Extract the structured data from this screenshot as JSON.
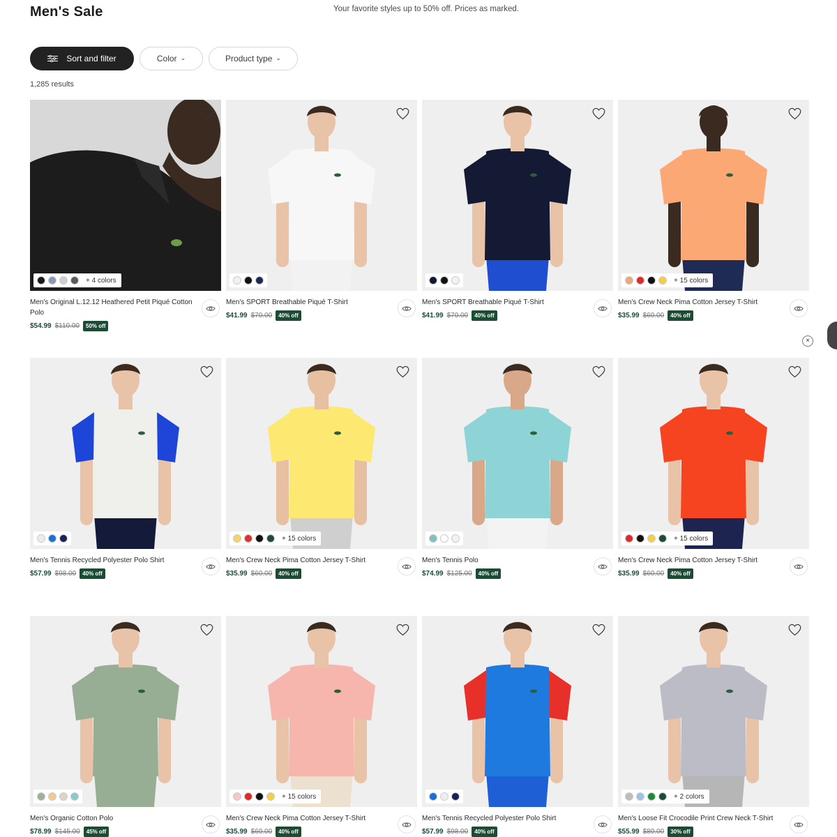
{
  "header": {
    "title": "Men's Sale",
    "promo": "Your favorite styles up to 50% off. Prices as marked."
  },
  "filters": {
    "sort_label": "Sort and filter",
    "color_label": "Color",
    "product_type_label": "Product type"
  },
  "results_count": "1,285 results",
  "products": [
    {
      "name": "Men's Original L.12.12 Heathered Petit Piqué Cotton Polo",
      "price": "$54.99",
      "was": "$110.00",
      "badge": "50% off",
      "swatches": [
        "#1a1a1a",
        "#8b97b4",
        "#cfcfcf",
        "#5a5a5a"
      ],
      "more": "+ 4 colors",
      "shirt": "#1c1c1c",
      "pants": "#1c1c1c",
      "sleeve": "#1c1c1c",
      "skin": "#3b2a20",
      "bg": "#d8d8d8"
    },
    {
      "name": "Men's SPORT Breathable Piqué T-Shirt",
      "price": "$41.99",
      "was": "$70.00",
      "badge": "40% off",
      "swatches": [
        "#f2f2f6",
        "#111111",
        "#1a2a55"
      ],
      "more": "",
      "shirt": "#f7f7f7",
      "pants": "#f2f2f2",
      "sleeve": "#f7f7f7",
      "skin": "#e8c3a8",
      "bg": "#efefef"
    },
    {
      "name": "Men's SPORT Breathable Piqué T-Shirt",
      "price": "$41.99",
      "was": "$70.00",
      "badge": "40% off",
      "swatches": [
        "#111833",
        "#111111",
        "#f2f2f6"
      ],
      "more": "",
      "shirt": "#141a33",
      "pants": "#1f4fd0",
      "sleeve": "#141a33",
      "skin": "#e8c3a8",
      "bg": "#efefef"
    },
    {
      "name": "Men's Crew Neck Pima Cotton Jersey T-Shirt",
      "price": "$35.99",
      "was": "$60.00",
      "badge": "40% off",
      "swatches": [
        "#f0a67a",
        "#e02a2a",
        "#111111",
        "#f2cf49"
      ],
      "more": "+ 15 colors",
      "shirt": "#fca874",
      "pants": "#1d2b55",
      "sleeve": "#fca874",
      "skin": "#3a2a20",
      "bg": "#efefef"
    },
    {
      "name": "Men's Tennis Recycled Polyester Polo Shirt",
      "price": "$57.99",
      "was": "$98.00",
      "badge": "40% off",
      "swatches": [
        "#ececea",
        "#1a6fd6",
        "#1a2355"
      ],
      "more": "",
      "shirt": "#efefec",
      "pants": "#141a3a",
      "sleeve": "#1d45d8",
      "skin": "#e8c3a8",
      "bg": "#efefef"
    },
    {
      "name": "Men's Crew Neck Pima Cotton Jersey T-Shirt",
      "price": "$35.99",
      "was": "$60.00",
      "badge": "40% off",
      "swatches": [
        "#f5d26a",
        "#e03030",
        "#111111",
        "#1b4d35"
      ],
      "more": "+ 15 colors",
      "shirt": "#fde972",
      "pants": "#cfcfcf",
      "sleeve": "#fde972",
      "skin": "#e6c0a0",
      "bg": "#efefef"
    },
    {
      "name": "Men's Tennis Polo",
      "price": "$74.99",
      "was": "$125.00",
      "badge": "40% off",
      "swatches": [
        "#7fc0c0",
        "#ffffff",
        "#f2f2f6"
      ],
      "more": "",
      "shirt": "#8ed3d6",
      "pants": "#f3f3f3",
      "sleeve": "#8ed3d6",
      "skin": "#d9a888",
      "bg": "#efefef"
    },
    {
      "name": "Men's Crew Neck Pima Cotton Jersey T-Shirt",
      "price": "$35.99",
      "was": "$60.00",
      "badge": "40% off",
      "swatches": [
        "#e02a2a",
        "#111111",
        "#f2cf49",
        "#1b4d35"
      ],
      "more": "+ 15 colors",
      "shirt": "#f5441f",
      "pants": "#1d2450",
      "sleeve": "#f5441f",
      "skin": "#e8c3a8",
      "bg": "#efefef"
    },
    {
      "name": "Men's Organic Cotton Polo",
      "price": "$78.99",
      "was": "$145.00",
      "badge": "45% off",
      "swatches": [
        "#9fb19a",
        "#f2c993",
        "#dcd4c6",
        "#8cc9c9"
      ],
      "more": "",
      "shirt": "#98ae94",
      "pants": "#98ae94",
      "sleeve": "#98ae94",
      "skin": "#e8c3a8",
      "bg": "#efefef"
    },
    {
      "name": "Men's Crew Neck Pima Cotton Jersey T-Shirt",
      "price": "$35.99",
      "was": "$60.00",
      "badge": "40% off",
      "swatches": [
        "#f5c8c8",
        "#e02a2a",
        "#111111",
        "#f2cf49"
      ],
      "more": "+ 15 colors",
      "shirt": "#f6b5ad",
      "pants": "#ece1cf",
      "sleeve": "#f6b5ad",
      "skin": "#e8c3a8",
      "bg": "#efefef"
    },
    {
      "name": "Men's Tennis Recycled Polyester Polo Shirt",
      "price": "$57.99",
      "was": "$98.00",
      "badge": "40% off",
      "swatches": [
        "#1a6fd6",
        "#eeeeee",
        "#1a2355"
      ],
      "more": "",
      "shirt": "#1f7ae0",
      "pants": "#1f5fd6",
      "sleeve": "#e8302a",
      "skin": "#e8c3a8",
      "bg": "#efefef"
    },
    {
      "name": "Men's Loose Fit Crocodile Print Crew Neck T-Shirt",
      "price": "$55.99",
      "was": "$80.00",
      "badge": "30% off",
      "swatches": [
        "#bdbdbd",
        "#9ec2e8",
        "#1b8a3a",
        "#1b4d35"
      ],
      "more": "+ 2 colors",
      "shirt": "#bcbcc6",
      "pants": "#b6b6b6",
      "sleeve": "#bcbcc6",
      "skin": "#e8c3a8",
      "bg": "#efefef"
    }
  ],
  "icons": {
    "heart": "heart-icon",
    "quick_view": "eye-icon",
    "filter": "sliders-icon",
    "chevron": "chevron-down-icon",
    "close": "close-icon"
  },
  "side_close_glyph": "×"
}
